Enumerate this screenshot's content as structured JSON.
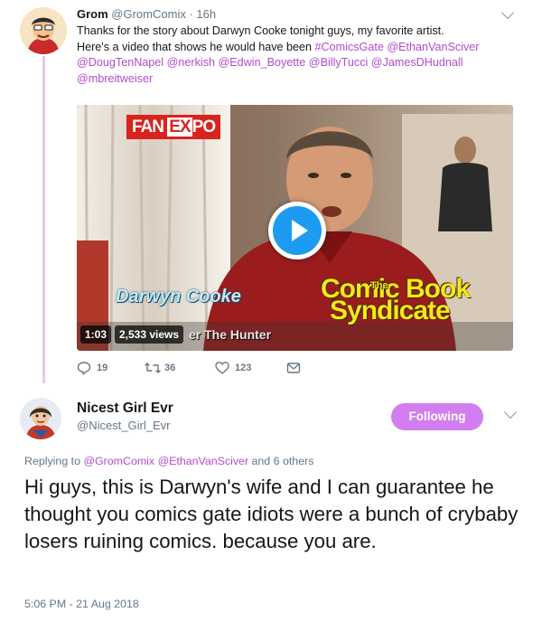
{
  "tweet1": {
    "name": "Grom",
    "handle": "@GromComix",
    "sep": " · ",
    "time": "16h",
    "text_line1": "Thanks for the story about Darwyn Cooke tonight guys, my favorite artist.",
    "text_line2": "Here's a video that shows he would have been ",
    "links_line2": [
      "#ComicsGate",
      "@EthanVanSciver"
    ],
    "links_line3": [
      "@DougTenNapel",
      "@nerkish",
      "@Edwin_Boyette",
      "@BillyTucci",
      "@JamesDHudnall"
    ],
    "links_line4": [
      "@mbreitweiser"
    ],
    "video": {
      "duration": "1:03",
      "views": "2,533 views",
      "overlay_brand_a": "FAN ",
      "overlay_brand_x": "EX",
      "overlay_brand_b": "PO",
      "overlay_name": "Darwyn Cooke",
      "overlay_caption": "er The Hunter",
      "overlay_the": "The",
      "overlay_logo_1": "Comic Book",
      "overlay_logo_2": "Syndicate"
    },
    "actions": {
      "replies": "19",
      "retweets": "36",
      "likes": "123"
    }
  },
  "tweet2": {
    "name": "Nicest Girl Evr",
    "handle": "@Nicest_Girl_Evr",
    "follow_label": "Following",
    "replying_prefix": "Replying to ",
    "replying_users": [
      "@GromComix",
      "@EthanVanSciver"
    ],
    "replying_suffix": " and 6 others",
    "text": "Hi guys, this is Darwyn's wife and I can guarantee he thought you comics gate idiots were a bunch of crybaby losers ruining comics. because you are.",
    "timestamp": "5:06 PM - 21 Aug 2018"
  },
  "colors": {
    "link": "#b44ad0",
    "follow_button": "#d27ef0",
    "thread_line": "#e3c6f0",
    "play_button": "#1d9bf0"
  }
}
